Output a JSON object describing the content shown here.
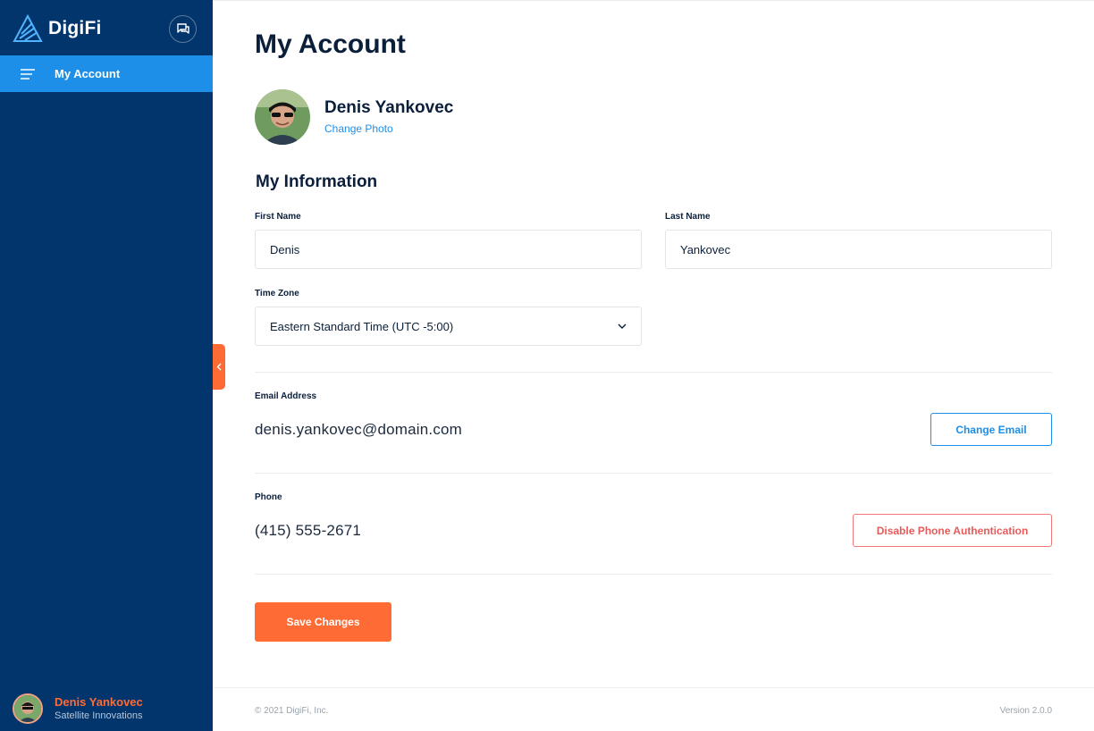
{
  "sidebar": {
    "brand": "DigiFi",
    "nav_active_label": "My Account",
    "user": {
      "name": "Denis Yankovec",
      "organization": "Satellite Innovations"
    }
  },
  "main": {
    "title": "My Account",
    "profile": {
      "name": "Denis Yankovec",
      "change_photo_label": "Change Photo"
    },
    "section_title": "My Information",
    "first_name": {
      "label": "First Name",
      "value": "Denis"
    },
    "last_name": {
      "label": "Last Name",
      "value": "Yankovec"
    },
    "time_zone": {
      "label": "Time Zone",
      "value": "Eastern Standard Time (UTC -5:00)"
    },
    "email": {
      "label": "Email Address",
      "value": "denis.yankovec@domain.com",
      "button_label": "Change Email"
    },
    "phone": {
      "label": "Phone",
      "value": "(415) 555-2671",
      "button_label": "Disable Phone Authentication"
    },
    "save_label": "Save Changes"
  },
  "footer": {
    "copyright": "© 2021 DigiFi, Inc.",
    "version": "Version 2.0.0"
  },
  "colors": {
    "sidebar_bg": "#02356b",
    "nav_active_bg": "#1e8fe8",
    "accent_orange": "#ff6b35",
    "link_blue": "#1e8fe8",
    "danger_red": "#ea5a5a"
  },
  "icons": [
    "digifi-logo-icon",
    "chat-icon",
    "menu-icon",
    "chevron-left-icon",
    "chevron-down-icon"
  ]
}
